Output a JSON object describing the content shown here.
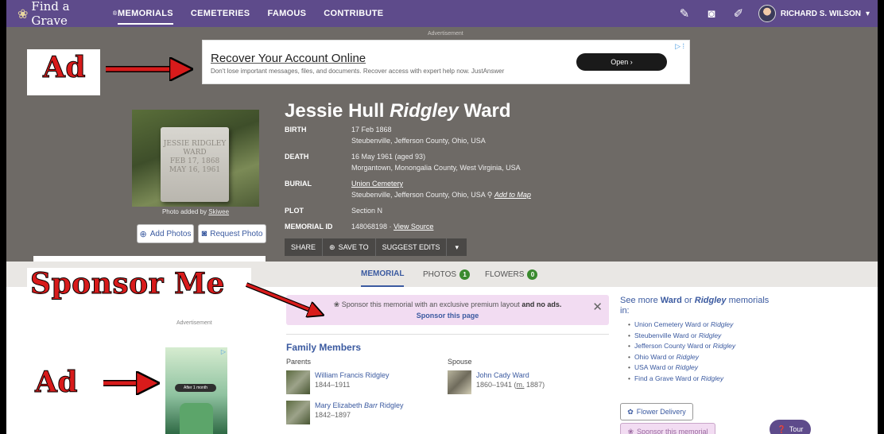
{
  "nav": {
    "logo_text": "Find a Grave",
    "logo_mark": "®",
    "links": [
      "MEMORIALS",
      "CEMETERIES",
      "FAMOUS",
      "CONTRIBUTE"
    ],
    "active": "MEMORIALS",
    "user_name": "RICHARD S. WILSON",
    "icons": [
      "edit-icon",
      "camera-icon",
      "pencil-icon"
    ]
  },
  "top_ad": {
    "label": "Advertisement",
    "headline": "Recover Your Account Online",
    "subtext": "Don't lose important messages, files, and documents. Recover access with expert help now. JustAnswer",
    "button": "Open ›"
  },
  "photo": {
    "stone_lines": [
      "JESSIE RIDGLEY",
      "WARD",
      "FEB 17, 1868",
      "MAY 16, 1961"
    ],
    "credit_prefix": "Photo added by",
    "credit_user": "Skiwee",
    "add_photos": "Add Photos",
    "request_photo": "Request Photo"
  },
  "memorial": {
    "name_first": "Jessie Hull",
    "name_maiden": "Ridgley",
    "name_last": "Ward",
    "birth_label": "BIRTH",
    "birth_date": "17 Feb 1868",
    "birth_place": "Steubenville, Jefferson County, Ohio, USA",
    "death_label": "DEATH",
    "death_date": "16 May 1961 (aged 93)",
    "death_place": "Morgantown, Monongalia County, West Virginia, USA",
    "burial_label": "BURIAL",
    "burial_cemetery": "Union Cemetery",
    "burial_place": "Steubenville, Jefferson County, Ohio, USA",
    "add_to_map": "Add to Map",
    "plot_label": "PLOT",
    "plot": "Section N",
    "id_label": "MEMORIAL ID",
    "id_value": "148068198 ·",
    "view_source": "View Source"
  },
  "actions": {
    "share": "SHARE",
    "save_to": "SAVE TO",
    "suggest": "SUGGEST EDITS",
    "caret": "▾"
  },
  "tabs": [
    {
      "label": "MEMORIAL",
      "count": ""
    },
    {
      "label": "PHOTOS",
      "count": "1"
    },
    {
      "label": "FLOWERS",
      "count": "0"
    }
  ],
  "sponsor": {
    "text": "Sponsor this memorial with an exclusive premium layout",
    "bold": "and no ads.",
    "link": "Sponsor this page"
  },
  "left_ad": {
    "label": "Advertisement",
    "pill": "After 1 month"
  },
  "family": {
    "title": "Family Members",
    "parents_label": "Parents",
    "spouse_label": "Spouse",
    "parents": [
      {
        "name": "William Francis Ridgley",
        "dates": "1844–1911"
      },
      {
        "name_a": "Mary Elizabeth ",
        "name_i": "Barr",
        "name_b": " Ridgley",
        "dates": "1842–1897"
      }
    ],
    "spouse": {
      "name": "John Cady Ward",
      "dates_a": "1860–1941 (",
      "dates_m": "m.",
      "dates_b": " 1887)"
    }
  },
  "see_more": {
    "prefix": "See more",
    "surname": "Ward",
    "or": "or",
    "maiden": "Ridgley",
    "suffix": "memorials in:",
    "items": [
      {
        "pre": "Union Cemetery Ward or",
        "it": "Ridgley"
      },
      {
        "pre": "Steubenville Ward or",
        "it": "Ridgley"
      },
      {
        "pre": "Jefferson County Ward or",
        "it": "Ridgley"
      },
      {
        "pre": "Ohio Ward or",
        "it": "Ridgley"
      },
      {
        "pre": "USA Ward or",
        "it": "Ridgley"
      },
      {
        "pre": "Find a Grave Ward or",
        "it": "Ridgley"
      }
    ],
    "flower_delivery": "Flower Delivery",
    "sponsor_memorial": "Sponsor this memorial",
    "tour": "Tour"
  },
  "annotations": {
    "ad_top": "Ad",
    "sponsor_me": "Sponsor Me",
    "ad_left": "Ad",
    "color": "#d81b1b"
  }
}
